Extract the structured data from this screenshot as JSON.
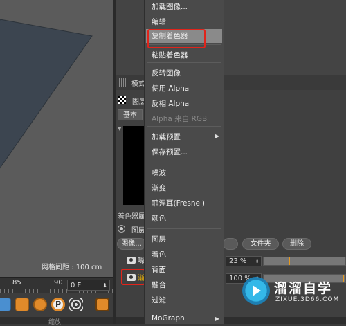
{
  "viewport": {
    "grid_spacing": "网格间距 : 100 cm"
  },
  "timeline": {
    "ticks": [
      "85",
      "90"
    ],
    "frame_value": "0 F"
  },
  "status_bar": {
    "text": "缩放"
  },
  "attributes": {
    "header_label": "模式",
    "layer_label": "图层",
    "tab_basic": "基本",
    "shader_label": "着色器属",
    "layer_radio_label": "图层",
    "buttons": {
      "image": "图像...",
      "folder": "文件夹",
      "delete": "删除"
    },
    "rows": [
      {
        "name": "噪",
        "percent": "23 %",
        "slider_fraction": 0.44
      },
      {
        "name": "渐",
        "percent": "100 %",
        "slider_fraction": 1.0
      }
    ]
  },
  "context_menu": {
    "items": [
      {
        "label": "加载图像...",
        "disabled": false
      },
      {
        "label": "编辑",
        "disabled": false
      },
      {
        "label": "复制着色器",
        "disabled": false,
        "highlight": true
      },
      {
        "label": "粘贴着色器",
        "disabled": false
      },
      {
        "label": "反转图像",
        "disabled": false
      },
      {
        "label": "使用 Alpha",
        "disabled": false
      },
      {
        "label": "反相 Alpha",
        "disabled": false
      },
      {
        "label": "Alpha 来自 RGB",
        "disabled": true
      },
      {
        "label": "加载预置",
        "disabled": false,
        "submenu": true
      },
      {
        "label": "保存预置...",
        "disabled": false
      },
      {
        "label": "噪波",
        "disabled": false
      },
      {
        "label": "渐变",
        "disabled": false
      },
      {
        "label": "菲涅耳(Fresnel)",
        "disabled": false
      },
      {
        "label": "颜色",
        "disabled": false
      },
      {
        "label": "图层",
        "disabled": false
      },
      {
        "label": "着色",
        "disabled": false
      },
      {
        "label": "背面",
        "disabled": false
      },
      {
        "label": "融合",
        "disabled": false
      },
      {
        "label": "过滤",
        "disabled": false
      },
      {
        "label": "MoGraph",
        "disabled": false,
        "submenu": true
      }
    ]
  },
  "watermark": {
    "title": "溜溜自学",
    "subtitle": "ZIXUE.3D66.COM"
  },
  "colors": {
    "highlight_border": "#e0241b",
    "menu_bg": "#4a4a4a",
    "viewport_plane": "#3d4650"
  }
}
